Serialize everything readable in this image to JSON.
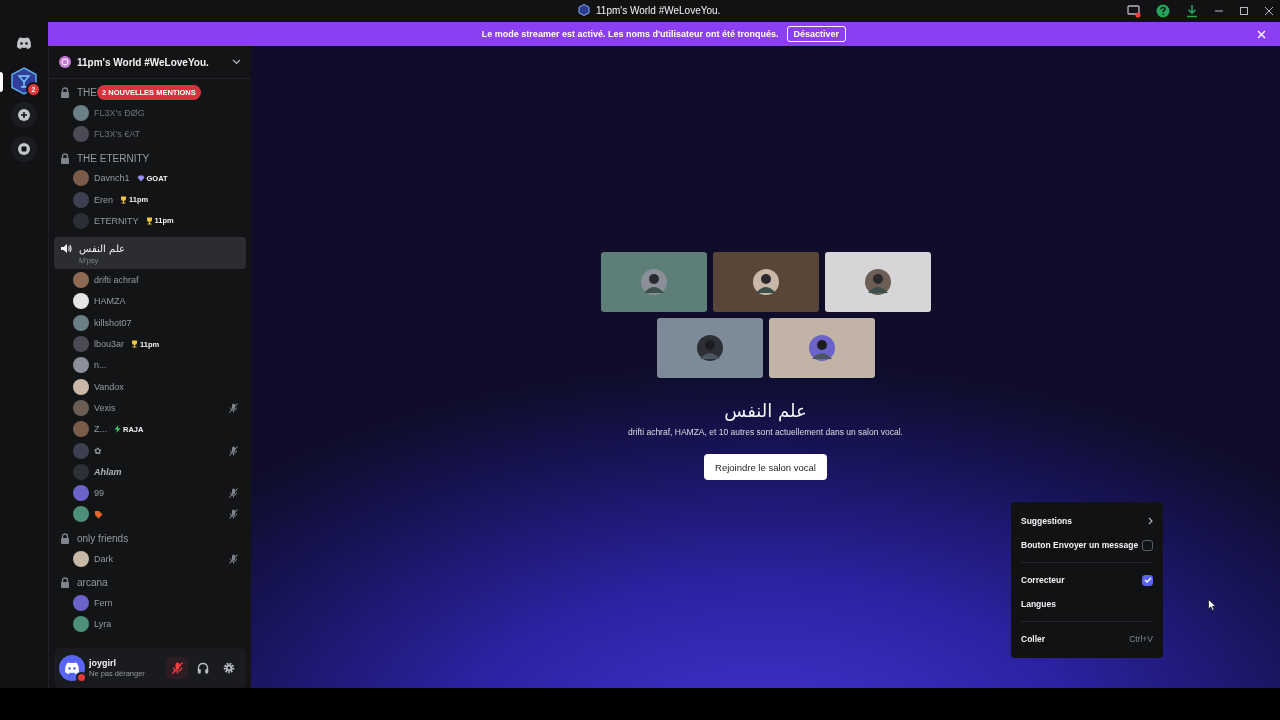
{
  "window": {
    "title": "11pm's World #WeLoveYou."
  },
  "banner": {
    "text": "Le mode streamer est activé. Les noms d'utilisateur ont été tronqués.",
    "button": "Désactiver"
  },
  "servers": [
    {
      "kind": "home",
      "selected": false
    },
    {
      "kind": "server",
      "selected": true,
      "badge": "2"
    },
    {
      "kind": "add",
      "selected": false
    },
    {
      "kind": "explore",
      "selected": false
    }
  ],
  "server_name": "11pm's World #WeLoveYou.",
  "mentions_badge": "2 NOUVELLES MENTIONS",
  "channels": [
    {
      "name": "THE",
      "kind": "locked",
      "selected": false,
      "members": [
        {
          "name": "FL3X's ĐØG",
          "muted": false,
          "dim": true
        },
        {
          "name": "FL3X's €AT",
          "muted": false,
          "dim": true
        }
      ]
    },
    {
      "name": "THE ETERNITY",
      "kind": "locked",
      "selected": false,
      "members": [
        {
          "name": "Davnch1",
          "muted": false,
          "dim": false,
          "tag": {
            "kind": "diamond",
            "text": "GOAT"
          }
        },
        {
          "name": "Eren",
          "muted": false,
          "dim": false,
          "tag": {
            "kind": "trophy",
            "text": "11pm"
          }
        },
        {
          "name": "ETERNITY",
          "muted": false,
          "dim": false,
          "tag": {
            "kind": "trophy",
            "text": "11pm"
          }
        }
      ]
    },
    {
      "name": "علم النفس",
      "kind": "voice",
      "selected": true,
      "status": "M'psy",
      "members": [
        {
          "name": "drifti achraf",
          "muted": false,
          "dim": false
        },
        {
          "name": "HAMZA",
          "muted": false,
          "dim": false
        },
        {
          "name": "killshot07",
          "muted": false,
          "dim": false
        },
        {
          "name": "lbou3ar",
          "muted": false,
          "dim": false,
          "tag": {
            "kind": "trophy",
            "text": "11pm"
          }
        },
        {
          "name": "n...",
          "muted": false,
          "dim": false
        },
        {
          "name": "Vandox",
          "muted": false,
          "dim": false
        },
        {
          "name": "Vexis",
          "muted": true,
          "dim": false
        },
        {
          "name": "Z...",
          "muted": false,
          "dim": false,
          "tag": {
            "kind": "bolt",
            "text": "RAJA"
          }
        },
        {
          "name": "✿",
          "muted": true,
          "dim": false
        },
        {
          "name": "Ahlam",
          "muted": false,
          "dim": false,
          "emphasis": true
        },
        {
          "name": "99",
          "muted": true,
          "dim": false
        },
        {
          "kind": "emoji",
          "muted": true,
          "dim": false
        }
      ]
    },
    {
      "name": "only friends",
      "kind": "locked",
      "selected": false,
      "members": [
        {
          "name": "Dark",
          "muted": true,
          "dim": false
        }
      ]
    },
    {
      "name": "arcana",
      "kind": "locked",
      "selected": false,
      "members": [
        {
          "name": "Fern",
          "muted": false,
          "dim": false
        },
        {
          "name": "Lyra",
          "muted": false,
          "dim": false
        }
      ]
    }
  ],
  "user": {
    "name": "joygirl",
    "status": "Ne pas déranger",
    "mic_muted": true
  },
  "voice": {
    "tiles": [
      {
        "color": "#5d7f78"
      },
      {
        "color": "#5a4638"
      },
      {
        "color": "#d6d6d8"
      },
      {
        "color": "#7d8a98"
      },
      {
        "color": "#c1b3a6"
      }
    ],
    "title": "علم النفس",
    "subtitle": "drifti achraf, HAMZA, et 10 autres sont actuellement dans un salon vocal.",
    "button": "Rejoindre le salon vocal"
  },
  "context_menu": [
    {
      "kind": "submenu",
      "label": "Suggestions"
    },
    {
      "kind": "checkbox",
      "label": "Bouton Envoyer un message",
      "checked": false
    },
    {
      "kind": "separator"
    },
    {
      "kind": "checkbox",
      "label": "Correcteur",
      "checked": true
    },
    {
      "kind": "plain",
      "label": "Langues"
    },
    {
      "kind": "separator"
    },
    {
      "kind": "shortcut",
      "label": "Coller",
      "shortcut": "Ctrl+V"
    }
  ]
}
